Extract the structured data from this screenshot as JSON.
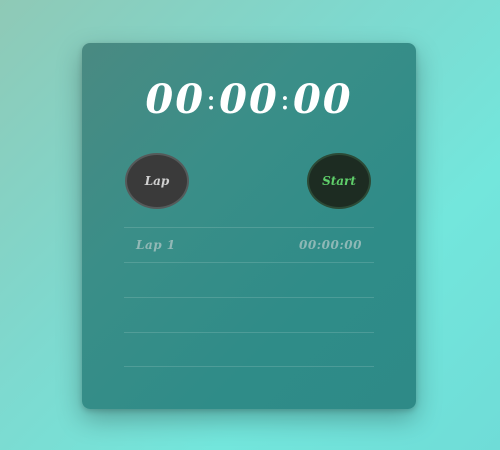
{
  "display": {
    "minutes": "00",
    "seconds": "00",
    "centiseconds": "00",
    "separator": ":"
  },
  "buttons": {
    "lap_label": "Lap",
    "start_label": "Start"
  },
  "laps": [
    {
      "label": "Lap 1",
      "time": "00:00:00"
    },
    {
      "label": "",
      "time": ""
    },
    {
      "label": "",
      "time": ""
    },
    {
      "label": "",
      "time": ""
    }
  ],
  "colors": {
    "start_text": "#5fcf6a",
    "lap_button_bg": "#3a3a3a",
    "start_button_bg": "#1d2c22"
  }
}
